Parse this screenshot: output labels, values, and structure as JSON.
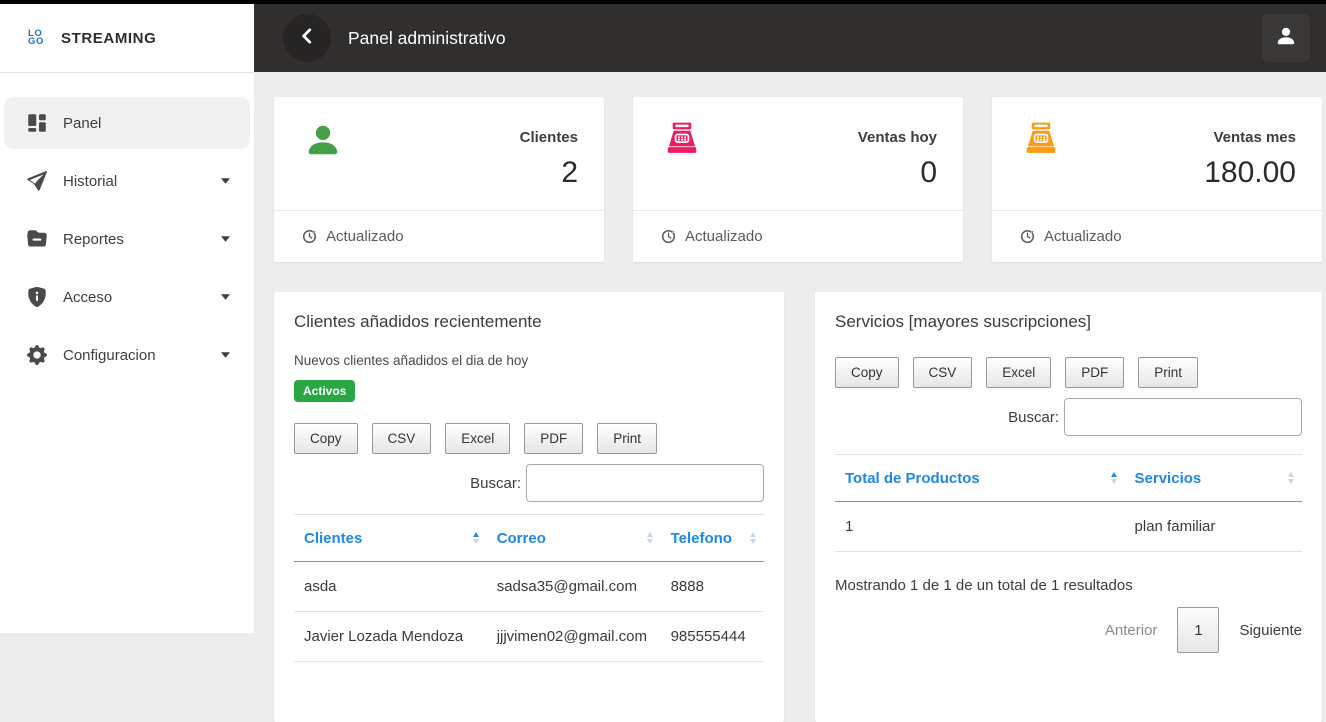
{
  "brand": {
    "logo_line1": "LO",
    "logo_line2": "GO",
    "name": "STREAMING"
  },
  "sidebar": {
    "items": [
      {
        "label": "Panel",
        "icon": "dashboard",
        "active": true,
        "caret": false
      },
      {
        "label": "Historial",
        "icon": "send",
        "active": false,
        "caret": true
      },
      {
        "label": "Reportes",
        "icon": "folder",
        "active": false,
        "caret": true
      },
      {
        "label": "Acceso",
        "icon": "shield-info",
        "active": false,
        "caret": true
      },
      {
        "label": "Configuracion",
        "icon": "gear",
        "active": false,
        "caret": true
      }
    ]
  },
  "topbar": {
    "title": "Panel administrativo"
  },
  "cards": [
    {
      "label": "Clientes",
      "value": "2",
      "icon": "person",
      "color": "#43a047",
      "footer": "Actualizado"
    },
    {
      "label": "Ventas hoy",
      "value": "0",
      "icon": "cash-register",
      "color": "#e91e63",
      "footer": "Actualizado"
    },
    {
      "label": "Ventas mes",
      "value": "180.00",
      "icon": "cash-register",
      "color": "#fd9a12",
      "footer": "Actualizado"
    }
  ],
  "clients_panel": {
    "title": "Clientes añadidos recientemente",
    "subtitle": "Nuevos clientes añadidos el dia de hoy",
    "badge": "Activos",
    "badge_color": "#28a745",
    "export_buttons": [
      "Copy",
      "CSV",
      "Excel",
      "PDF",
      "Print"
    ],
    "search_label": "Buscar:",
    "search_value": "",
    "table": {
      "headers": [
        {
          "label": "Clientes",
          "sort": "asc"
        },
        {
          "label": "Correo",
          "sort": "none"
        },
        {
          "label": "Telefono",
          "sort": "none"
        }
      ],
      "col_widths": [
        "41%",
        "37%",
        "22%"
      ],
      "rows": [
        [
          "asda",
          "sadsa35@gmail.com",
          "8888"
        ],
        [
          "Javier Lozada Mendoza",
          "jjjvimen02@gmail.com",
          "985555444"
        ]
      ]
    }
  },
  "services_panel": {
    "title": "Servicios [mayores suscripciones]",
    "export_buttons": [
      "Copy",
      "CSV",
      "Excel",
      "PDF",
      "Print"
    ],
    "search_label": "Buscar:",
    "search_value": "",
    "table": {
      "headers": [
        {
          "label": "Total de Productos",
          "sort": "asc"
        },
        {
          "label": "Servicios",
          "sort": "none"
        }
      ],
      "col_widths": [
        "62%",
        "38%"
      ],
      "rows": [
        [
          "1",
          "plan familiar"
        ]
      ]
    },
    "results_text": "Mostrando 1 de 1 de un total de 1 resultados",
    "pagination": {
      "previous": "Anterior",
      "page": "1",
      "next": "Siguiente"
    }
  },
  "colors": {
    "topbar_bg": "#312e2e",
    "accent_blue": "#1e88e5",
    "brand_blue": "#1a6fe3",
    "success_green": "#28a745",
    "pink": "#e91e63",
    "orange": "#fd9a12",
    "page_bg": "#ededed"
  }
}
